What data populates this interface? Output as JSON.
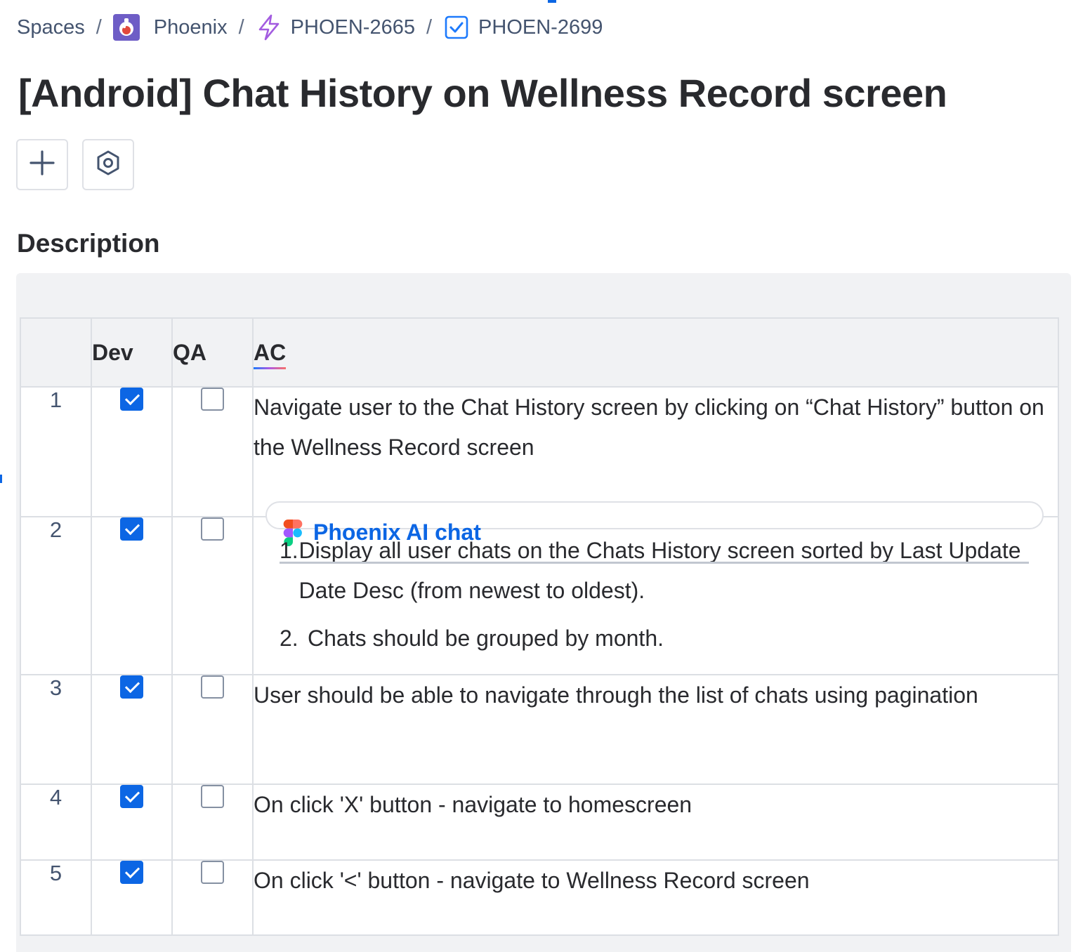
{
  "breadcrumb": {
    "items": [
      {
        "label": "Spaces",
        "icon": ""
      },
      {
        "label": "Phoenix",
        "icon": "phoenix-project-avatar"
      },
      {
        "label": "PHOEN-2665",
        "icon": "epic-lightning-icon"
      },
      {
        "label": "PHOEN-2699",
        "icon": "task-checkbox-icon"
      }
    ],
    "separator": "/"
  },
  "page": {
    "title": "[Android] Chat History on Wellness Record screen"
  },
  "toolbar": {
    "add_icon": "plus-icon",
    "apps_icon": "hexagon-settings-icon"
  },
  "description": {
    "heading": "Description",
    "table": {
      "headers": [
        "",
        "Dev",
        "QA",
        "AC"
      ],
      "rows": [
        {
          "num": "1",
          "dev": true,
          "qa": false,
          "ac": "Navigate user to the Chat History screen by clicking on “Chat History” button on the Wellness Record screen"
        },
        {
          "num": "2",
          "dev": true,
          "qa": false,
          "ac": ""
        },
        {
          "num": "3",
          "dev": true,
          "qa": false,
          "ac": "User should be able to navigate through the list of chats using pagination"
        },
        {
          "num": "4",
          "dev": true,
          "qa": false,
          "ac": "On click 'X' button - navigate to homescreen"
        },
        {
          "num": "5",
          "dev": true,
          "qa": false,
          "ac": "On click '<' button - navigate to  Wellness Record screen"
        }
      ]
    },
    "figma_link": {
      "label": "Phoenix AI chat",
      "icon": "figma-icon"
    },
    "row2_list": [
      {
        "n": "1.",
        "text": "Display all user chats on the Chats History screen sorted by Last Update Date Desc (from newest to oldest)."
      },
      {
        "n": "2.",
        "text": "Chats should be grouped by month."
      }
    ]
  },
  "colors": {
    "accent": "#0c66e4",
    "border": "#dcdfe4",
    "header_bg": "#f1f2f4"
  }
}
